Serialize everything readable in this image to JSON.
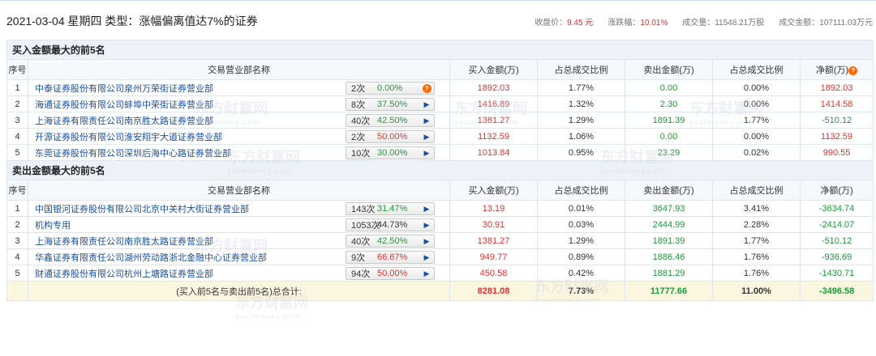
{
  "header": {
    "title": "2021-03-04 星期四  类型：涨幅偏离值达7%的证券",
    "close_label": "收盘价：",
    "close_value": "9.45 元",
    "change_label": "涨跌幅：",
    "change_value": "10.01%",
    "volume": "成交量：11548.21万股",
    "turnover": "成交金额：107111.03万元"
  },
  "buy_section": {
    "title": "买入金额最大的前5名",
    "columns": [
      "序号",
      "交易营业部名称",
      "买入金额(万)",
      "占总成交比例",
      "卖出金额(万)",
      "占总成交比例",
      "净额(万)"
    ],
    "rows": [
      {
        "idx": "1",
        "name": "中泰证券股份有限公司泉州万荣街证券营业部",
        "count": "2次",
        "pct": "0.00%",
        "pct_color": "g",
        "buy": "1892.03",
        "buy_ratio": "1.77%",
        "sell": "0.00",
        "sell_ratio": "0.00%",
        "net": "1892.03",
        "net_color": "r",
        "arrow": "?"
      },
      {
        "idx": "2",
        "name": "海通证券股份有限公司蚌埠中荣街证券营业部",
        "count": "8次",
        "pct": "37.50%",
        "pct_color": "g",
        "buy": "1416.89",
        "buy_ratio": "1.32%",
        "sell": "2.30",
        "sell_ratio": "0.00%",
        "net": "1414.58",
        "net_color": "r",
        "arrow": "▶"
      },
      {
        "idx": "3",
        "name": "上海证券有限责任公司南京胜太路证券营业部",
        "count": "40次",
        "pct": "42.50%",
        "pct_color": "g",
        "buy": "1381.27",
        "buy_ratio": "1.29%",
        "sell": "1891.39",
        "sell_ratio": "1.77%",
        "net": "-510.12",
        "net_color": "g",
        "arrow": "▶"
      },
      {
        "idx": "4",
        "name": "开源证券股份有限公司淮安翔宇大道证券营业部",
        "count": "2次",
        "pct": "50.00%",
        "pct_color": "r",
        "buy": "1132.59",
        "buy_ratio": "1.06%",
        "sell": "0.00",
        "sell_ratio": "0.00%",
        "net": "1132.59",
        "net_color": "r",
        "arrow": "▶"
      },
      {
        "idx": "5",
        "name": "东莞证券股份有限公司深圳后海中心路证券营业部",
        "count": "10次",
        "pct": "30.00%",
        "pct_color": "g",
        "buy": "1013.84",
        "buy_ratio": "0.95%",
        "sell": "23.29",
        "sell_ratio": "0.02%",
        "net": "990.55",
        "net_color": "r",
        "arrow": "▶"
      }
    ]
  },
  "sell_section": {
    "title": "卖出金额最大的前5名",
    "columns": [
      "序号",
      "交易营业部名称",
      "买入金额(万)",
      "占总成交比例",
      "卖出金额(万)",
      "占总成交比例",
      "净额(万)"
    ],
    "rows": [
      {
        "idx": "1",
        "name": "中国银河证券股份有限公司北京中关村大街证券营业部",
        "count": "143次",
        "pct": "31.47%",
        "pct_color": "g",
        "buy": "13.19",
        "buy_ratio": "0.01%",
        "sell": "3647.93",
        "sell_ratio": "3.41%",
        "net": "-3634.74",
        "net_color": "g",
        "arrow": "▶"
      },
      {
        "idx": "2",
        "name": "机构专用",
        "count": "1053次",
        "pct": "44.73%",
        "pct_color": "k",
        "buy": "30.91",
        "buy_ratio": "0.03%",
        "sell": "2444.99",
        "sell_ratio": "2.28%",
        "net": "-2414.07",
        "net_color": "g",
        "arrow": "▶"
      },
      {
        "idx": "3",
        "name": "上海证券有限责任公司南京胜太路证券营业部",
        "count": "40次",
        "pct": "42.50%",
        "pct_color": "g",
        "buy": "1381.27",
        "buy_ratio": "1.29%",
        "sell": "1891.39",
        "sell_ratio": "1.77%",
        "net": "-510.12",
        "net_color": "g",
        "arrow": "▶"
      },
      {
        "idx": "4",
        "name": "华鑫证券有限责任公司湖州劳动路浙北金融中心证券营业部",
        "count": "9次",
        "pct": "66.67%",
        "pct_color": "r",
        "buy": "949.77",
        "buy_ratio": "0.89%",
        "sell": "1886.46",
        "sell_ratio": "1.76%",
        "net": "-936.69",
        "net_color": "g",
        "arrow": "▶"
      },
      {
        "idx": "5",
        "name": "财通证券股份有限公司杭州上塘路证券营业部",
        "count": "94次",
        "pct": "50.00%",
        "pct_color": "r",
        "buy": "450.58",
        "buy_ratio": "0.42%",
        "sell": "1881.29",
        "sell_ratio": "1.76%",
        "net": "-1430.71",
        "net_color": "g",
        "arrow": "▶"
      }
    ]
  },
  "total": {
    "label": "(买入前5名与卖出前5名)总合计:",
    "buy": "8281.08",
    "buy_ratio": "7.73%",
    "sell": "11777.66",
    "sell_ratio": "11.00%",
    "net": "-3496.58"
  },
  "watermark": {
    "cn": "东方财富网",
    "en": "eastmoney.com"
  },
  "colors": {
    "red": "#e23232",
    "green": "#1f9a3a",
    "link": "#1d4e9e",
    "section_bg": "#edf2f9",
    "total_bg": "#fbf6df"
  }
}
